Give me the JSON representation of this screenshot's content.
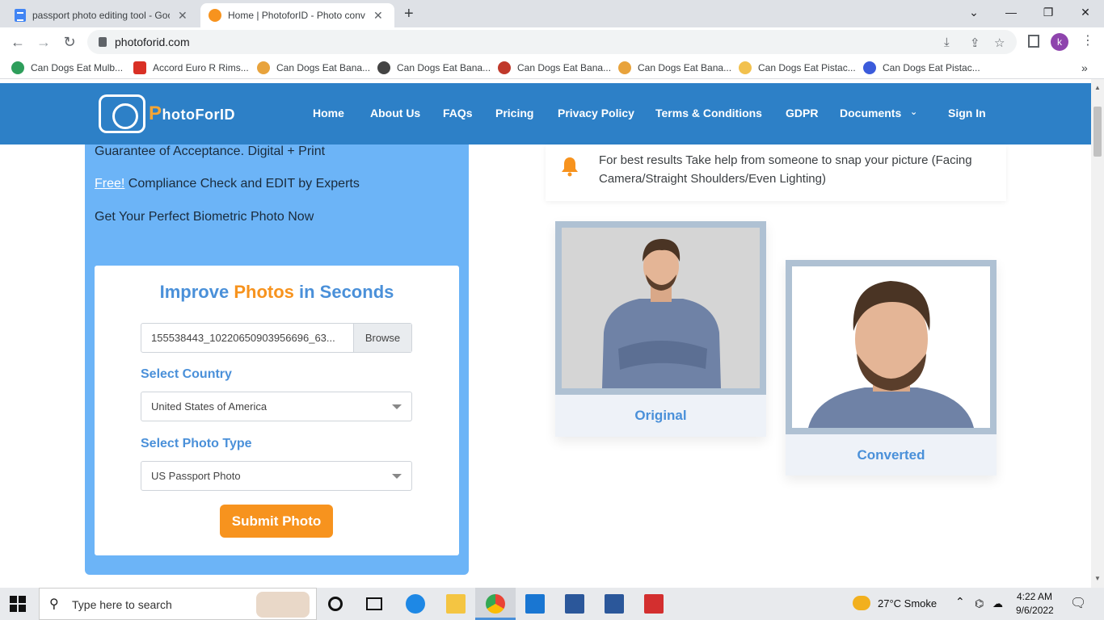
{
  "browser": {
    "tabs": [
      {
        "title": "passport photo editing tool - Goo",
        "favicon": "docs-icon"
      },
      {
        "title": "Home | PhotoforID - Photo conve",
        "favicon": "photoforid-icon"
      }
    ],
    "url": "photoforid.com",
    "profile_initial": "k"
  },
  "bookmarks": [
    "Can Dogs Eat Mulb...",
    "Accord Euro R Rims...",
    "Can Dogs Eat Bana...",
    "Can Dogs Eat Bana...",
    "Can Dogs Eat Bana...",
    "Can Dogs Eat Bana...",
    "Can Dogs Eat Pistac...",
    "Can Dogs Eat Pistac..."
  ],
  "site": {
    "logo_p": "P",
    "logo_rest": "hotoForID",
    "nav": [
      "Home",
      "About Us",
      "FAQs",
      "Pricing",
      "Privacy Policy",
      "Terms & Conditions",
      "GDPR",
      "Documents",
      "Sign In"
    ],
    "brand_color": "#2d80c7",
    "accent_color": "#f7931e"
  },
  "left_panel": {
    "line1": "Guarantee of Acceptance. Digital + Print",
    "line2_link": "Free!",
    "line2_rest": " Compliance Check and EDIT by Experts",
    "line3": "Get Your Perfect Biometric Photo Now"
  },
  "form": {
    "title_a": "Improve ",
    "title_b": "Photos",
    "title_c": " in Seconds",
    "file_value": "155538443_10220650903956696_63...",
    "browse_label": "Browse",
    "country_label": "Select Country",
    "country_value": "United States of America",
    "type_label": "Select Photo Type",
    "type_value": "US Passport Photo",
    "submit_label": "Submit Photo"
  },
  "tip": {
    "text": "For best results Take help from someone to snap your picture (Facing Camera/Straight Shoulders/Even Lighting)"
  },
  "samples": {
    "original_label": "Original",
    "converted_label": "Converted"
  },
  "taskbar": {
    "search_placeholder": "Type here to search",
    "weather": "27°C  Smoke",
    "time": "4:22 AM",
    "date": "9/6/2022"
  }
}
